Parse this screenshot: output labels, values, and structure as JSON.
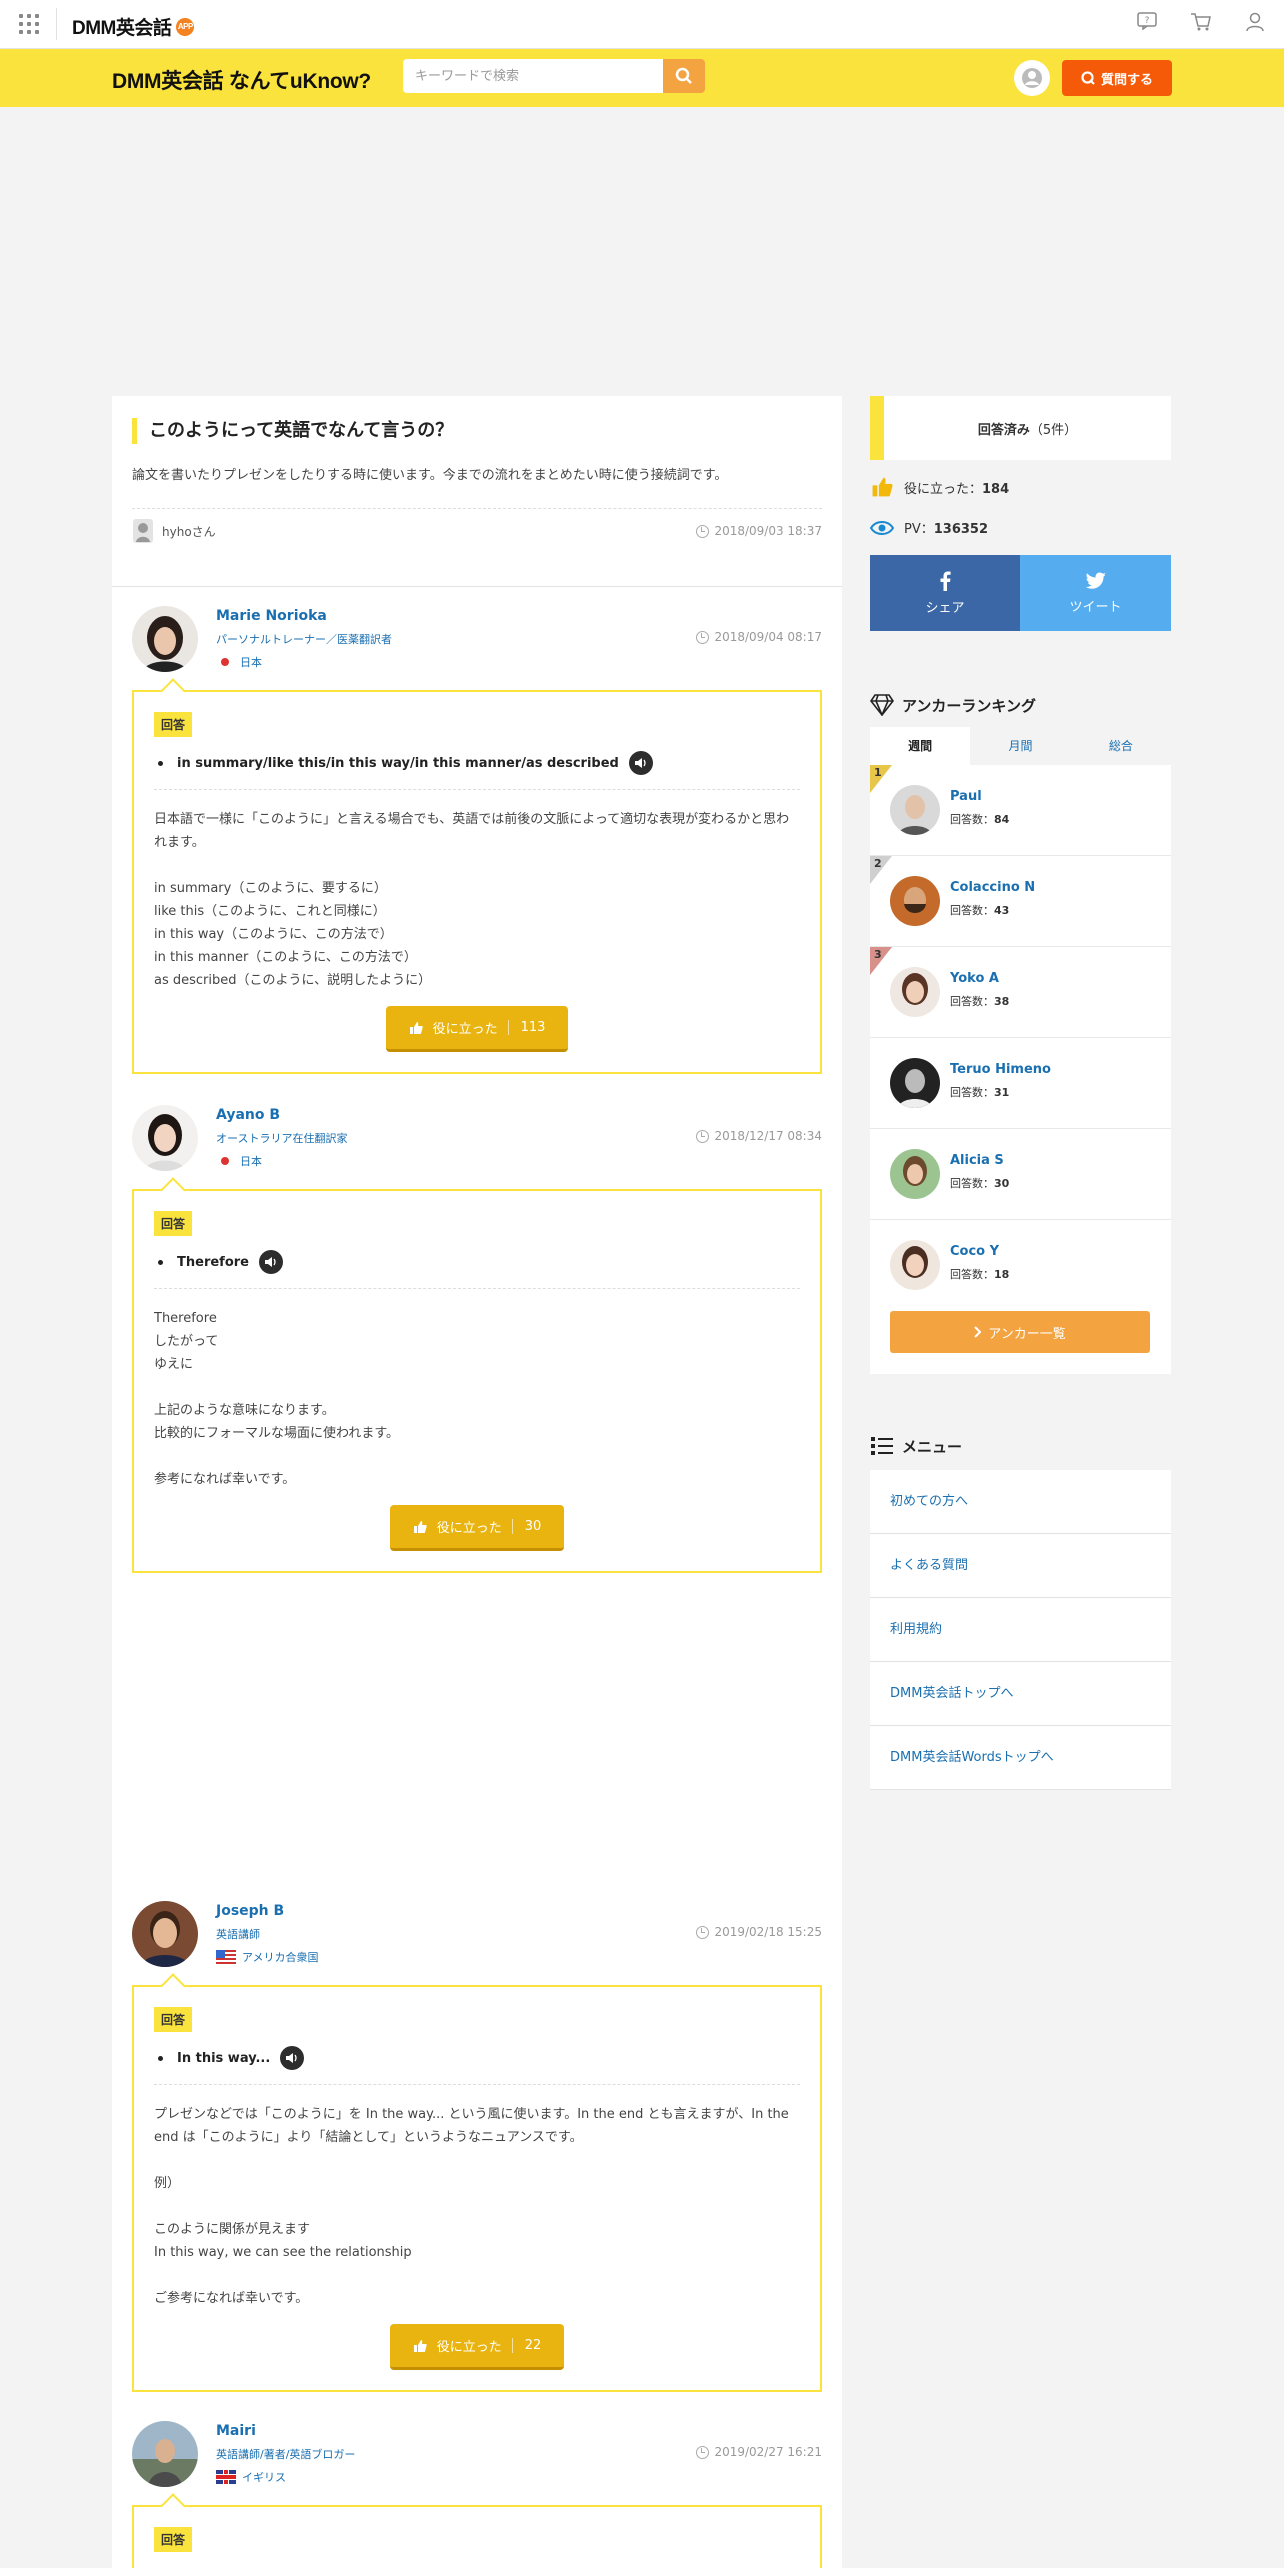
{
  "topbar": {
    "brand": "DMM英会話",
    "brand_badge": "APP"
  },
  "header": {
    "logo": "DMM英会話 なんてuKnow?",
    "search_placeholder": "キーワードで検索",
    "ask_label": "質問する"
  },
  "question": {
    "title": "このようにって英語でなんて言うの？",
    "body": "論文を書いたりプレゼンをしたりする時に使います。今までの流れをまとめたい時に使う接続詞です。",
    "user": "hyhoさん",
    "date": "2018/09/03 18:37"
  },
  "answer_label": "回答",
  "helpful_label": "役に立った",
  "answers": [
    {
      "name": "Marie Norioka",
      "job": "パーソナルトレーナー／医薬翻訳者",
      "country": "日本",
      "date": "2018/09/04 08:17",
      "phrase": "in summary/like this/in this way/in this manner/as described",
      "text": "日本語で一様に「このように」と言える場合でも、英語では前後の文脈によって適切な表現が変わるかと思われます。\n\nin summary（このように、要するに）\nlike this（このように、これと同様に）\nin this way（このように、この方法で）\nin this manner（このように、この方法で）\nas described（このように、説明したように）",
      "helpful": "113"
    },
    {
      "name": "Ayano B",
      "job": "オーストラリア在住翻訳家",
      "country": "日本",
      "date": "2018/12/17 08:34",
      "phrase": "Therefore",
      "text": "Therefore\nしたがって\nゆえに\n\n上記のような意味になります。\n比較的にフォーマルな場面に使われます。\n\n参考になれば幸いです。",
      "helpful": "30"
    },
    {
      "name": "Joseph B",
      "job": "英語講師",
      "country": "アメリカ合衆国",
      "date": "2019/02/18 15:25",
      "phrase": "In this way...",
      "text": "プレゼンなどでは「このように」を In the way... という風に使います。In the end とも言えますが、In the end は「このように」より「結論として」というようなニュアンスです。\n\n例）\n\nこのように関係が見えます\nIn this way, we can see the relationship\n\nご参考になれば幸いです。",
      "helpful": "22"
    },
    {
      "name": "Mairi",
      "job": "英語講師/著者/英語ブロガー",
      "country": "イギリス",
      "date": "2019/02/27 16:21"
    }
  ],
  "sidebar": {
    "answered_label": "回答済み",
    "answered_count": "（5件）",
    "helpful_label": "役に立った：",
    "helpful_count": "184",
    "pv_label": "PV：",
    "pv_count": "136352",
    "share_fb": "シェア",
    "share_tw": "ツイート",
    "ranking_title": "アンカーランキング",
    "tabs": [
      "週間",
      "月間",
      "総合"
    ],
    "count_label": "回答数：",
    "ranking": [
      {
        "rank": "1",
        "name": "Paul",
        "count": "84"
      },
      {
        "rank": "2",
        "name": "Colaccino N",
        "count": "43"
      },
      {
        "rank": "3",
        "name": "Yoko A",
        "count": "38"
      },
      {
        "rank": "",
        "name": "Teruo Himeno",
        "count": "31"
      },
      {
        "rank": "",
        "name": "Alicia S",
        "count": "30"
      },
      {
        "rank": "",
        "name": "Coco Y",
        "count": "18"
      }
    ],
    "anchor_list_label": "アンカー一覧",
    "menu_title": "メニュー",
    "menu": [
      "初めての方へ",
      "よくある質問",
      "利用規約",
      "DMM英会話トップへ",
      "DMM英会話Wordsトップへ"
    ]
  },
  "colors": {
    "yellow": "#fbe33d",
    "orange": "#f55a09",
    "link": "#1a6fb0",
    "gold_button": "#e9b40f"
  }
}
